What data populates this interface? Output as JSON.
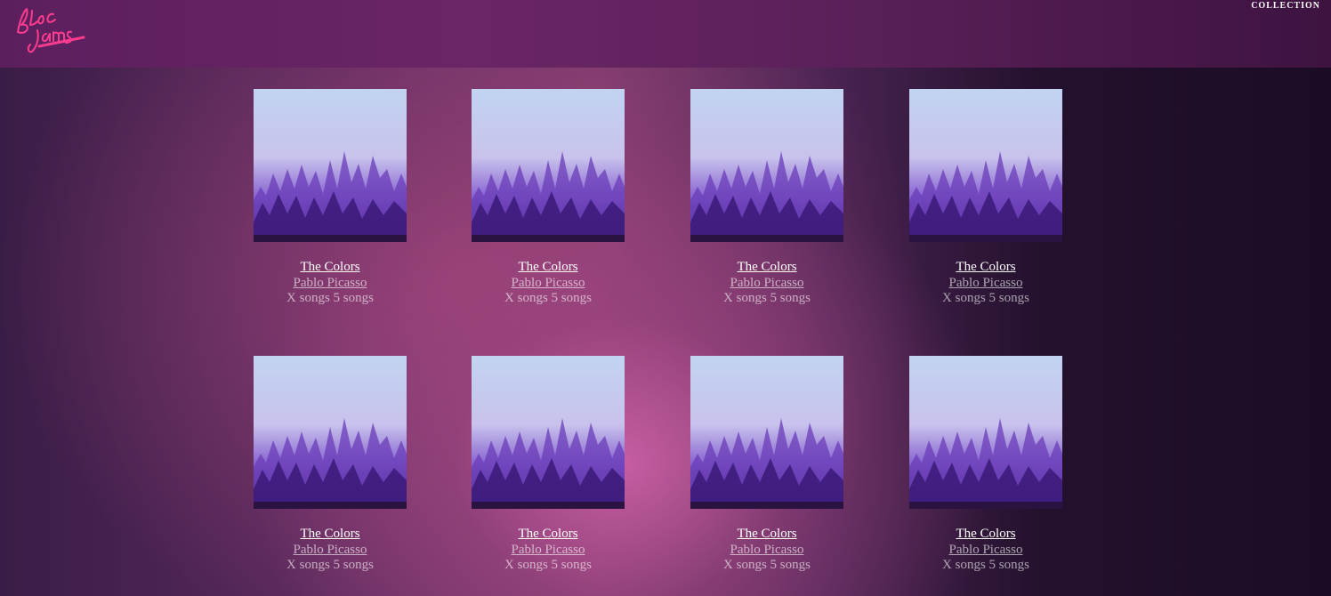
{
  "nav": {
    "logo_alt": "Bloc Jams",
    "collection_label": "COLLECTION"
  },
  "colors": {
    "navbar": "#5c1f5e",
    "logo_pink": "#ff3b8e",
    "title_text": "#ffffff",
    "secondary_text": "rgba(255,255,255,0.6)"
  },
  "albums": [
    {
      "title": "The Colors",
      "artist": "Pablo Picasso",
      "count": "X songs 5 songs",
      "cover_alt": "album-cover"
    },
    {
      "title": "The Colors",
      "artist": "Pablo Picasso",
      "count": "X songs 5 songs",
      "cover_alt": "album-cover"
    },
    {
      "title": "The Colors",
      "artist": "Pablo Picasso",
      "count": "X songs 5 songs",
      "cover_alt": "album-cover"
    },
    {
      "title": "The Colors",
      "artist": "Pablo Picasso",
      "count": "X songs 5 songs",
      "cover_alt": "album-cover"
    },
    {
      "title": "The Colors",
      "artist": "Pablo Picasso",
      "count": "X songs 5 songs",
      "cover_alt": "album-cover"
    },
    {
      "title": "The Colors",
      "artist": "Pablo Picasso",
      "count": "X songs 5 songs",
      "cover_alt": "album-cover"
    },
    {
      "title": "The Colors",
      "artist": "Pablo Picasso",
      "count": "X songs 5 songs",
      "cover_alt": "album-cover"
    },
    {
      "title": "The Colors",
      "artist": "Pablo Picasso",
      "count": "X songs 5 songs",
      "cover_alt": "album-cover"
    }
  ]
}
